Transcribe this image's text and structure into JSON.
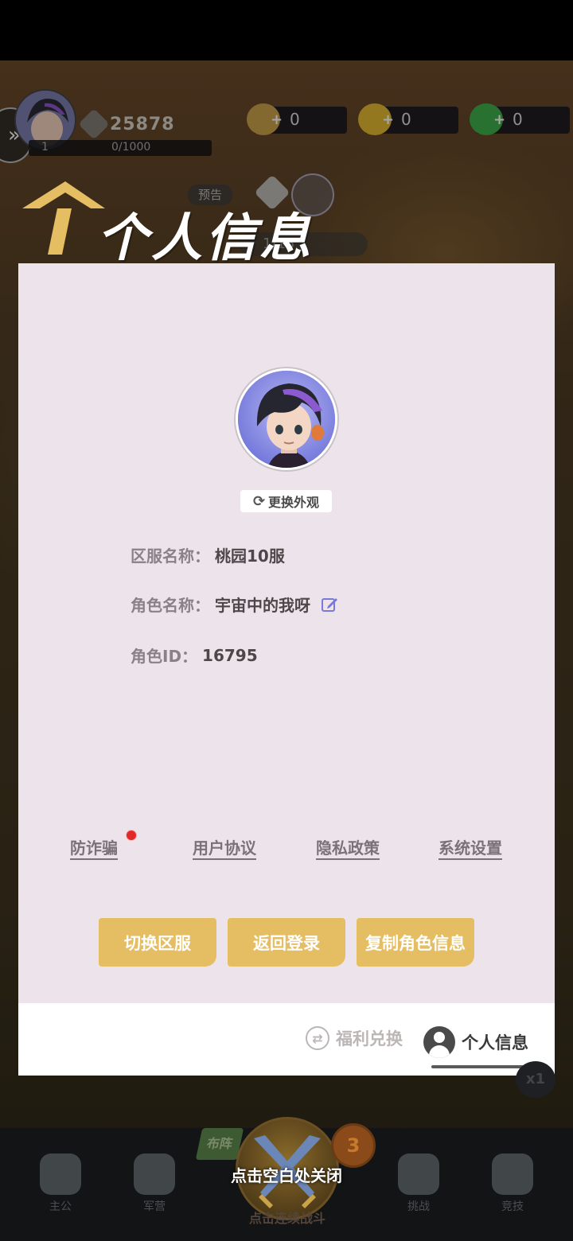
{
  "hud": {
    "combat_power": "25878",
    "level": "1",
    "exp": "0/1000",
    "currencies": [
      {
        "name": "copper-coin",
        "value": "0",
        "color": "#c9a24a"
      },
      {
        "name": "gold-ingot",
        "value": "0",
        "color": "#e2b832"
      },
      {
        "name": "jade",
        "value": "0",
        "color": "#3fae4a"
      }
    ],
    "stage_tag": "预告",
    "stage_progress": "1/15"
  },
  "title": "个人信息",
  "dialog": {
    "change_look": "更换外观",
    "server_label": "区服名称：",
    "server_value": "桃园10服",
    "role_name_label": "角色名称：",
    "role_name_value": "宇宙中的我呀",
    "role_id_label": "角色ID：",
    "role_id_value": "16795",
    "links": {
      "anti_fraud": "防诈骗",
      "user_agreement": "用户协议",
      "privacy_policy": "隐私政策",
      "system_settings": "系统设置"
    },
    "buttons": {
      "switch_server": "切换区服",
      "back_to_login": "返回登录",
      "copy_role_info": "复制角色信息"
    },
    "footer_tabs": {
      "welfare": "福利兑换",
      "profile": "个人信息"
    }
  },
  "bottom_nav": {
    "items": [
      "主公",
      "军营",
      "挑战",
      "竞技"
    ],
    "battle_label": "点击连续战斗",
    "formation": "布阵",
    "badge": "3",
    "speed": "x1"
  },
  "close_hint": "点击空白处关闭",
  "colors": {
    "accent_gold": "#e5bd63",
    "dialog_bg": "#ece4ea",
    "edit_icon": "#7a78d8"
  }
}
